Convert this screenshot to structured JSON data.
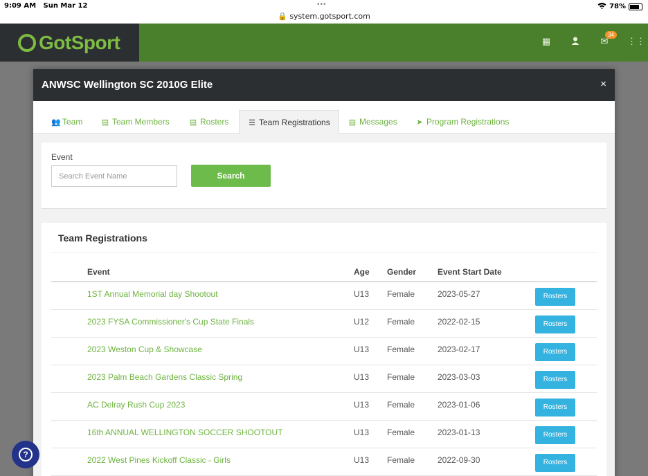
{
  "statusbar": {
    "time": "9:09 AM",
    "date": "Sun Mar 12",
    "url": "system.gotsport.com",
    "battery": "78%"
  },
  "header": {
    "logo_text": "GotSport",
    "badge_count": "34"
  },
  "modal": {
    "title": "ANWSC Wellington SC 2010G Elite",
    "close_label": "×",
    "tabs": [
      {
        "label": "Team",
        "icon": "users-icon"
      },
      {
        "label": "Team Members",
        "icon": "id-card-icon"
      },
      {
        "label": "Rosters",
        "icon": "id-card-icon"
      },
      {
        "label": "Team Registrations",
        "icon": "list-icon"
      },
      {
        "label": "Messages",
        "icon": "message-icon"
      },
      {
        "label": "Program Registrations",
        "icon": "paper-plane-icon"
      }
    ],
    "active_tab": "Team Registrations"
  },
  "search": {
    "label": "Event",
    "placeholder": "Search Event Name",
    "value": "",
    "button_label": "Search"
  },
  "registrations": {
    "title": "Team Registrations",
    "columns": [
      "Event",
      "Age",
      "Gender",
      "Event Start Date",
      ""
    ],
    "rows": [
      {
        "event": "1ST Annual Memorial day Shootout",
        "age": "U13",
        "gender": "Female",
        "start": "2023-05-27",
        "action": "Rosters"
      },
      {
        "event": "2023 FYSA Commissioner's Cup State Finals",
        "age": "U12",
        "gender": "Female",
        "start": "2022-02-15",
        "action": "Rosters"
      },
      {
        "event": "2023 Weston Cup & Showcase",
        "age": "U13",
        "gender": "Female",
        "start": "2023-02-17",
        "action": "Rosters"
      },
      {
        "event": "2023 Palm Beach Gardens Classic Spring",
        "age": "U13",
        "gender": "Female",
        "start": "2023-03-03",
        "action": "Rosters"
      },
      {
        "event": "AC Delray Rush Cup 2023",
        "age": "U13",
        "gender": "Female",
        "start": "2023-01-06",
        "action": "Rosters"
      },
      {
        "event": "16th ANNUAL WELLINGTON SOCCER SHOOTOUT",
        "age": "U13",
        "gender": "Female",
        "start": "2023-01-13",
        "action": "Rosters"
      },
      {
        "event": "2022 West Pines Kickoff Classic - Girls",
        "age": "U13",
        "gender": "Female",
        "start": "2022-09-30",
        "action": "Rosters"
      }
    ]
  },
  "help": {
    "label": "?"
  }
}
